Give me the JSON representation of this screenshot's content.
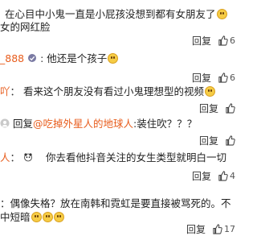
{
  "comments": [
    {
      "line1": "在心目中小鬼一直是小屁孩没想到都有女朋友了",
      "line2": "女的网红脸",
      "emoji": "grin-emoji",
      "reply_label": "回复",
      "like_count": "6"
    },
    {
      "user": "_888",
      "text": "他还是个孩子",
      "emoji": "smile-emoji",
      "reply_label": "回复",
      "like_count": "6"
    },
    {
      "user": "吖",
      "text": "看来这个朋友没有看过小鬼理想型的视频",
      "emoji": "smile-emoji",
      "reply_label": "回复"
    },
    {
      "text": "回复",
      "mention": "@吃掉外星人的地球人",
      "text2": "装住吹？？？",
      "reply_label": "回复"
    },
    {
      "user": "人",
      "text": "你去看他抖音关注的女生类型就明白一切",
      "reply_label": "回复",
      "like_count": "4"
    },
    {
      "line1": "偶像失格？放在南韩和霓虹是要直接被骂死的。不",
      "line2": "中短暗",
      "reply_label": "回复",
      "like_count": "17"
    }
  ],
  "colors": {
    "username": "#e85d1d",
    "text": "#222222",
    "muted": "#333333"
  }
}
